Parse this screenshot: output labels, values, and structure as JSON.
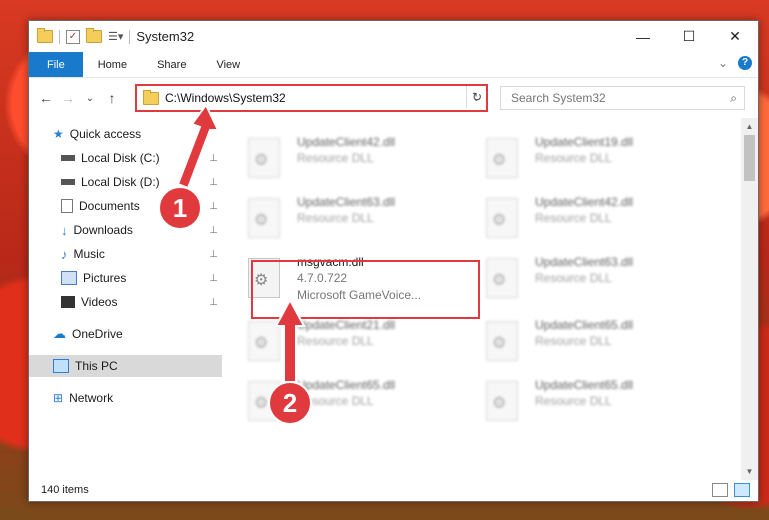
{
  "titlebar": {
    "title": "System32",
    "icons": [
      "folder-icon",
      "properties-icon",
      "new-folder-icon",
      "customize-icon"
    ],
    "minimize": "—",
    "maximize": "☐",
    "close": "✕"
  },
  "ribbon": {
    "tabs": [
      "File",
      "Home",
      "Share",
      "View"
    ],
    "expand": "⌄",
    "help": "?"
  },
  "nav": {
    "back": "←",
    "forward": "→",
    "recent": "⌄",
    "up": "↑"
  },
  "address": {
    "path": "C:\\Windows\\System32",
    "dropdown": "⌄",
    "refresh": "↻"
  },
  "search": {
    "placeholder": "Search System32",
    "icon": "⌕"
  },
  "sidebar": {
    "items": [
      {
        "label": "Quick access",
        "icon": "star-icon"
      },
      {
        "label": "Local Disk (C:)",
        "icon": "drive-icon",
        "pinned": true
      },
      {
        "label": "Local Disk (D:)",
        "icon": "drive-icon",
        "pinned": true
      },
      {
        "label": "Documents",
        "icon": "documents-icon",
        "pinned": true
      },
      {
        "label": "Downloads",
        "icon": "downloads-icon",
        "pinned": true
      },
      {
        "label": "Music",
        "icon": "music-icon",
        "pinned": true
      },
      {
        "label": "Pictures",
        "icon": "pictures-icon",
        "pinned": true
      },
      {
        "label": "Videos",
        "icon": "videos-icon",
        "pinned": true
      },
      {
        "label": "OneDrive",
        "icon": "cloud-icon"
      },
      {
        "label": "This PC",
        "icon": "computer-icon",
        "selected": true
      },
      {
        "label": "Network",
        "icon": "network-icon"
      }
    ],
    "pin_glyph": "📌"
  },
  "files": [
    {
      "name": "UpdateClient42.dll",
      "sub": "Resource DLL"
    },
    {
      "name": "UpdateClient19.dll",
      "sub": "Resource DLL"
    },
    {
      "name": "UpdateClient63.dll",
      "sub": "Resource DLL"
    },
    {
      "name": "UpdateClient42.dll",
      "sub": "Resource DLL"
    },
    {
      "name": "msgvacm.dll",
      "sub": "4.7.0.722",
      "desc": "Microsoft GameVoice...",
      "highlighted": true
    },
    {
      "name": "UpdateClient63.dll",
      "sub": "Resource DLL"
    },
    {
      "name": "UpdateClient21.dll",
      "sub": "Resource DLL"
    },
    {
      "name": "UpdateClient65.dll",
      "sub": "Resource DLL"
    },
    {
      "name": "UpdateClient65.dll",
      "sub": "Resource DLL"
    },
    {
      "name": "UpdateClient65.dll",
      "sub": "Resource DLL"
    }
  ],
  "status": {
    "count": "140 items"
  },
  "callouts": [
    "1",
    "2"
  ],
  "colors": {
    "accent": "#1979ca",
    "highlight": "#e0393e"
  }
}
